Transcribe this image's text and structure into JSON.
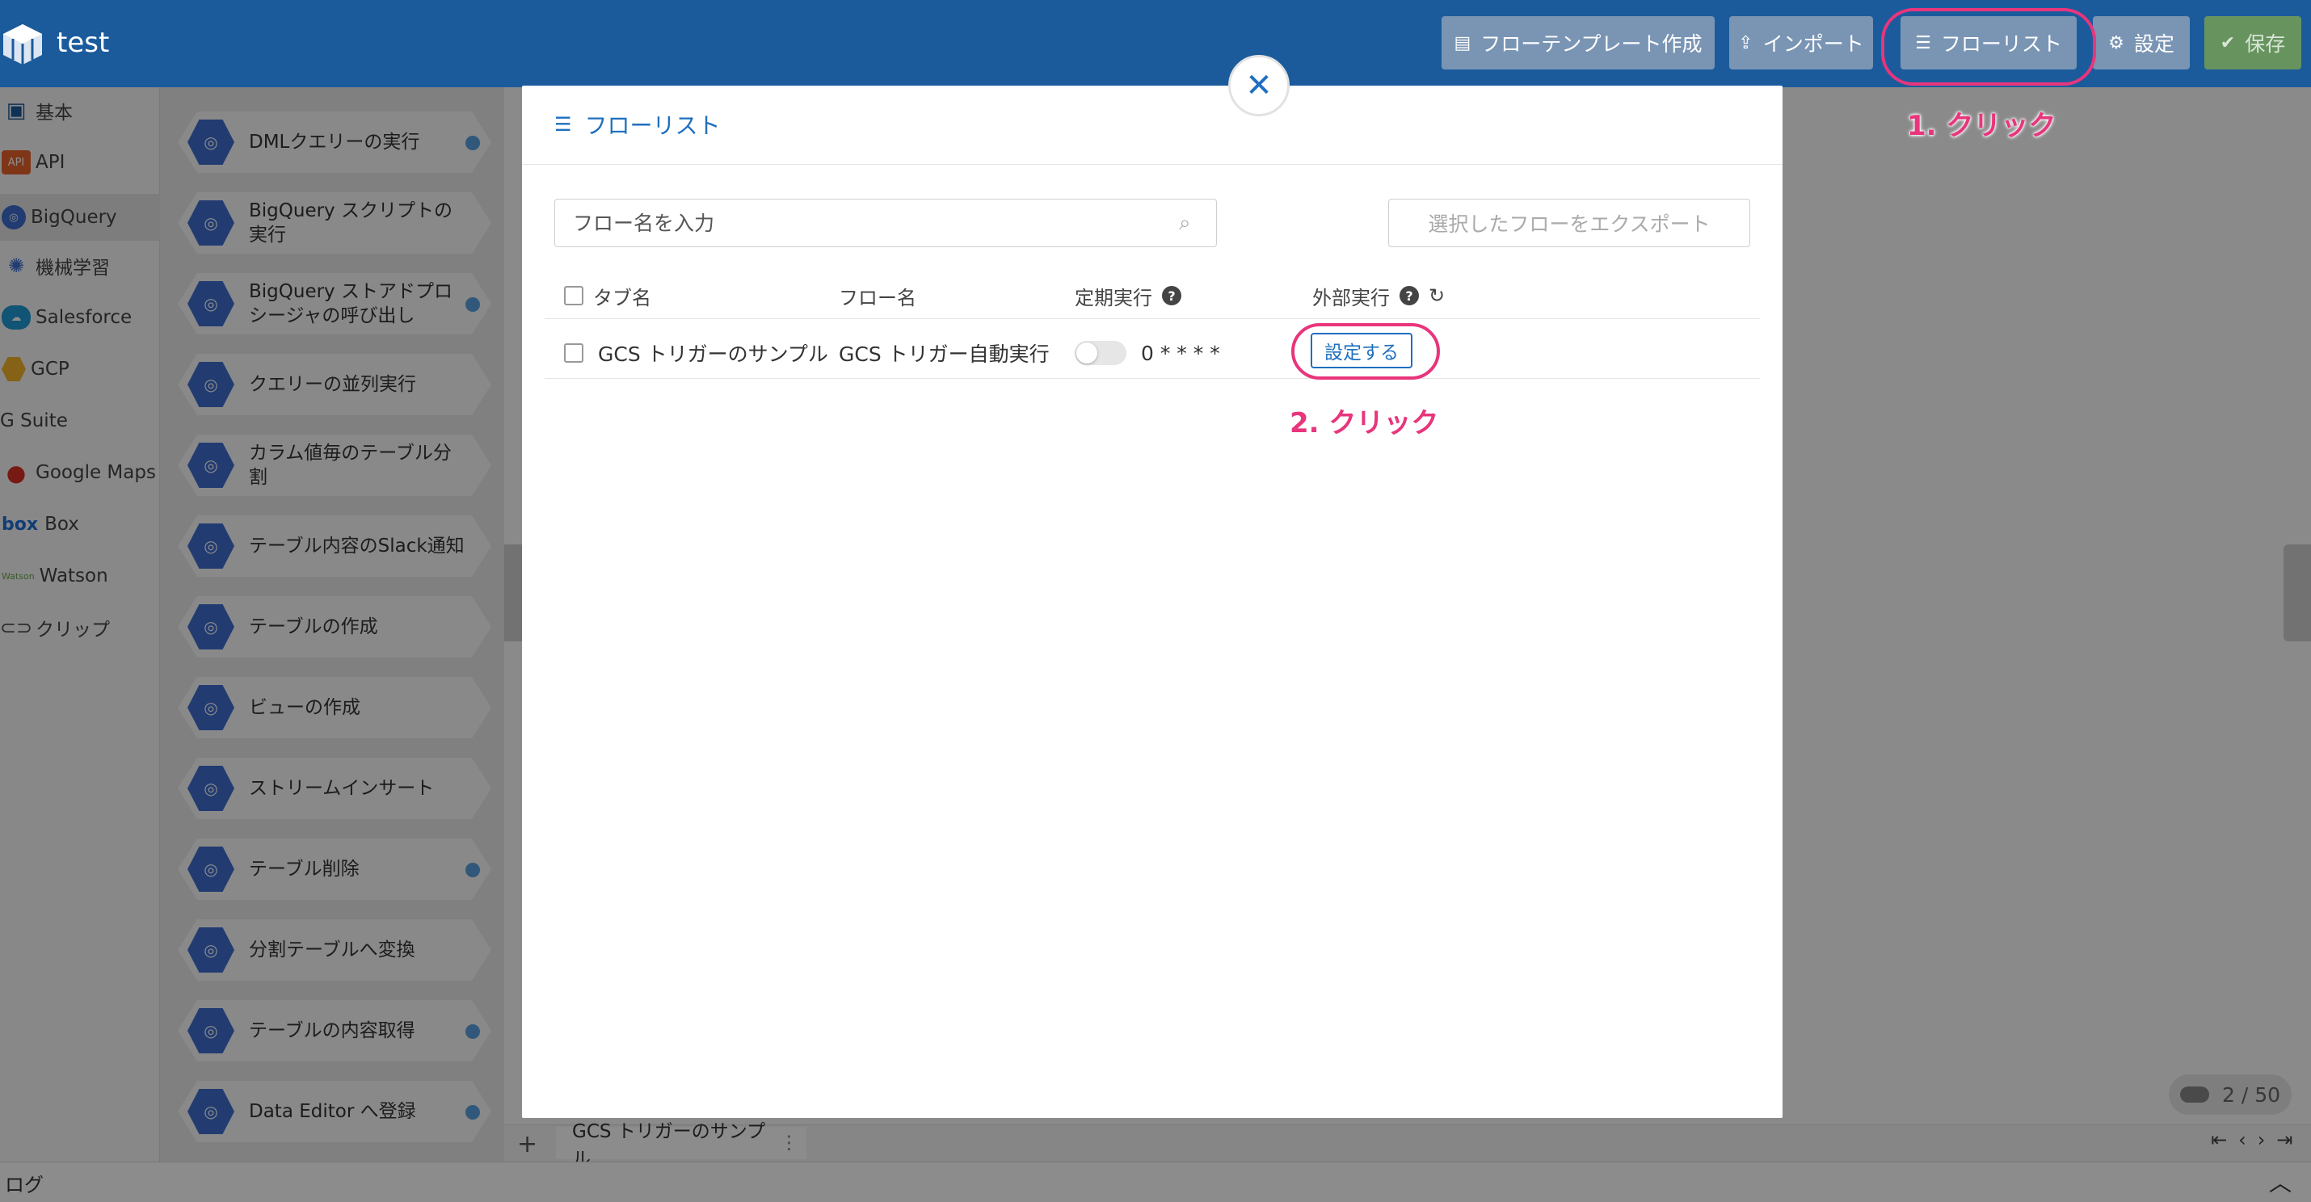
{
  "app": {
    "title": "test"
  },
  "header": {
    "buttons": [
      {
        "label": "フローテンプレート作成",
        "icon": "document-icon"
      },
      {
        "label": "インポート",
        "icon": "upload-icon"
      },
      {
        "label": "フローリスト",
        "icon": "list-icon"
      },
      {
        "label": "設定",
        "icon": "gear-icon"
      },
      {
        "label": "保存",
        "icon": "check-circle-icon"
      }
    ]
  },
  "sidebar": {
    "categories": [
      {
        "label": "基本",
        "icon_text": ""
      },
      {
        "label": "API",
        "icon_text": "API"
      },
      {
        "label": "BigQuery",
        "icon_text": ""
      },
      {
        "label": "機械学習",
        "icon_text": ""
      },
      {
        "label": "Salesforce",
        "icon_text": ""
      },
      {
        "label": "GCP",
        "icon_text": ""
      },
      {
        "label": "G Suite",
        "icon_text": "G Suite"
      },
      {
        "label": "Google Maps",
        "icon_text": ""
      },
      {
        "label": "Box",
        "icon_text": "box"
      },
      {
        "label": "Watson",
        "icon_text": "Watson"
      },
      {
        "label": "クリップ",
        "icon_text": ""
      }
    ]
  },
  "palette": {
    "nodes": [
      {
        "label": "DMLクエリーの実行"
      },
      {
        "label": "BigQuery スクリプトの実行"
      },
      {
        "label": "BigQuery ストアドプロシージャの呼び出し"
      },
      {
        "label": "クエリーの並列実行"
      },
      {
        "label": "カラム値毎のテーブル分割"
      },
      {
        "label": "テーブル内容のSlack通知"
      },
      {
        "label": "テーブルの作成"
      },
      {
        "label": "ビューの作成"
      },
      {
        "label": "ストリームインサート"
      },
      {
        "label": "テーブル削除"
      },
      {
        "label": "分割テーブルへ変換"
      },
      {
        "label": "テーブルの内容取得"
      },
      {
        "label": "Data Editor へ登録"
      }
    ]
  },
  "canvas": {
    "page_indicator": "2 / 50"
  },
  "tabbar": {
    "tab_label": "GCS トリガーのサンプル"
  },
  "log": {
    "label": "ログ"
  },
  "modal": {
    "title": "フローリスト",
    "search_placeholder": "フロー名を入力",
    "export_label": "選択したフローをエクスポート",
    "columns": {
      "tab": "タブ名",
      "flow": "フロー名",
      "schedule": "定期実行",
      "external": "外部実行"
    },
    "rows": [
      {
        "tab": "GCS トリガーのサンプル",
        "flow": "GCS トリガー自動実行",
        "schedule": "0 * * * *",
        "enabled": false,
        "action": "設定する"
      }
    ]
  },
  "annotations": {
    "step1": "1. クリック",
    "step2": "2. クリック"
  },
  "colors": {
    "header": "#1b5b9c",
    "accent": "#1f6fbf",
    "annotation": "#e8357c"
  }
}
